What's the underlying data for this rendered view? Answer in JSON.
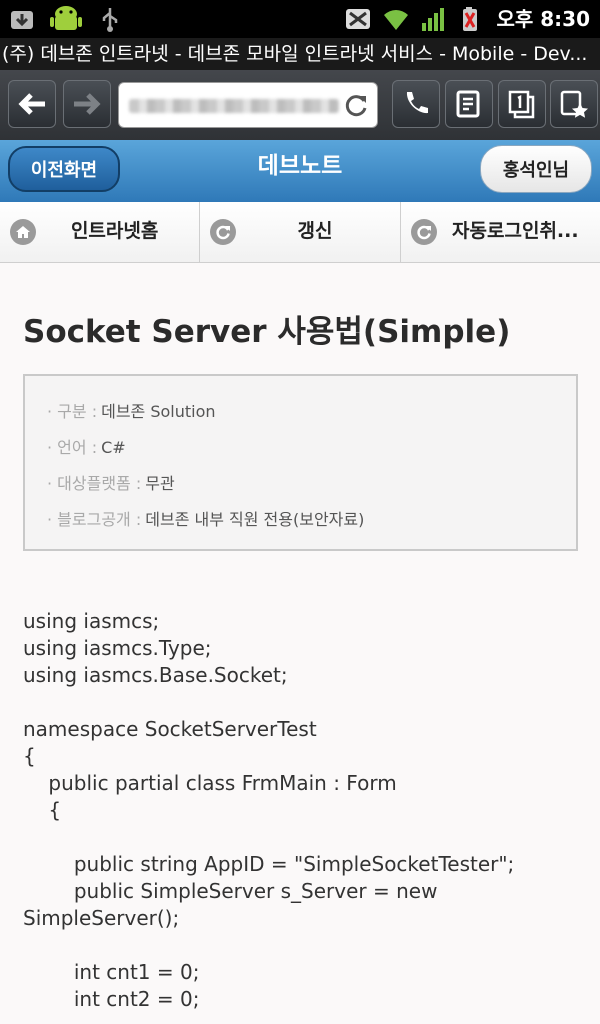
{
  "status_bar": {
    "time": "오후 8:30"
  },
  "window_title": "(주) 데브존 인트라넷 - 데브존 모바일 인트라넷 서비스 - Mobile - Dev...",
  "app_header": {
    "back_label": "이전화면",
    "title": "데브노트",
    "user_label": "홍석인님"
  },
  "nav": {
    "items": [
      {
        "label": "인트라넷홈",
        "icon": "home-icon"
      },
      {
        "label": "갱신",
        "icon": "refresh-icon"
      },
      {
        "label": "자동로그인취...",
        "icon": "refresh-icon"
      }
    ]
  },
  "post": {
    "title": "Socket Server 사용법(Simple)",
    "info": [
      {
        "label": "· 구분 :",
        "value": "데브존 Solution"
      },
      {
        "label": "· 언어 :",
        "value": "C#"
      },
      {
        "label": "· 대상플랫폼 :",
        "value": "무관"
      },
      {
        "label": "· 블로그공개 :",
        "value": "데브존 내부 직원 전용(보안자료)"
      }
    ],
    "code": "using iasmcs;\nusing iasmcs.Type;\nusing iasmcs.Base.Socket;\n\nnamespace SocketServerTest\n{\n    public partial class FrmMain : Form\n    {\n\n        public string AppID = \"SimpleSocketTester\";\n        public SimpleServer s_Server = new\nSimpleServer();\n\n        int cnt1 = 0;\n        int cnt2 = 0;"
  }
}
